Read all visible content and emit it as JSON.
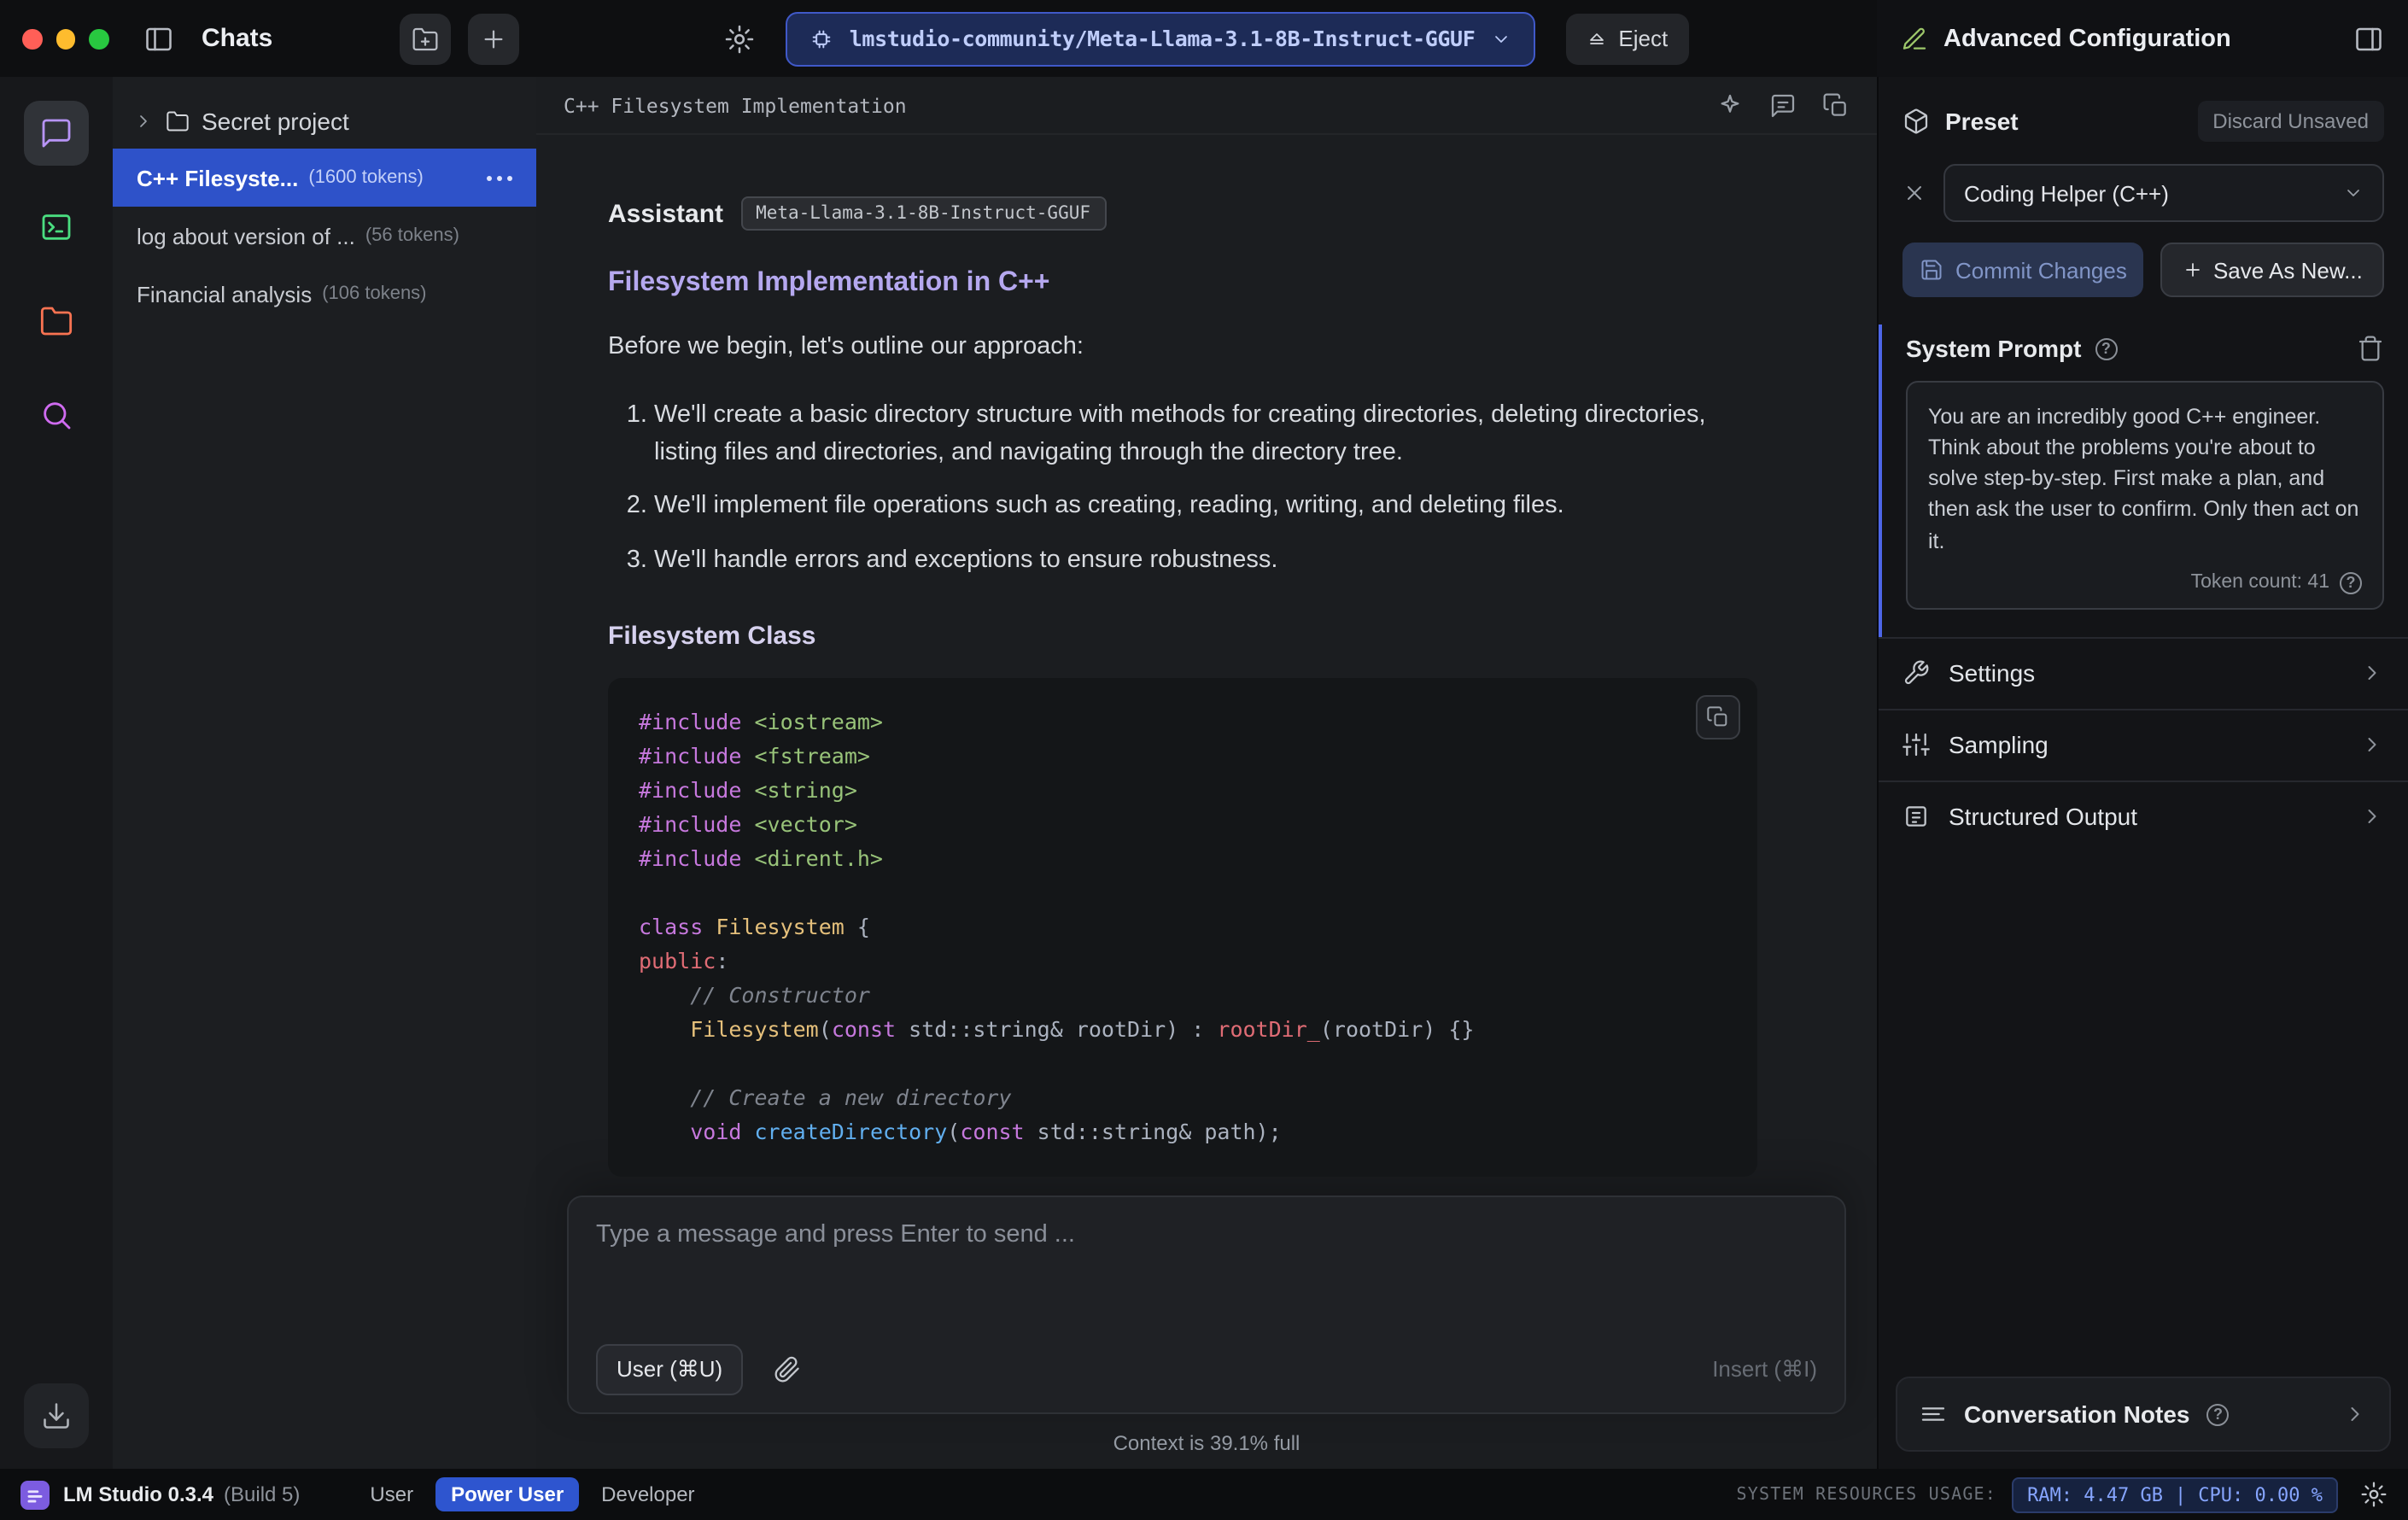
{
  "chats_panel": {
    "title": "Chats",
    "folder_label": "Secret project",
    "items": [
      {
        "label": "C++ Filesyste...",
        "tokens": "(1600 tokens)"
      },
      {
        "label": "log about version of ...",
        "tokens": "(56 tokens)"
      },
      {
        "label": "Financial analysis",
        "tokens": "(106 tokens)"
      }
    ]
  },
  "top_bar": {
    "model_name": "lmstudio-community/Meta-Llama-3.1-8B-Instruct-GGUF",
    "eject_label": "Eject"
  },
  "chat": {
    "header_title": "C++ Filesystem Implementation",
    "assistant_label": "Assistant",
    "model_badge": "Meta-Llama-3.1-8B-Instruct-GGUF",
    "heading_main": "Filesystem Implementation in C++",
    "intro": "Before we begin, let's outline our approach:",
    "list_items": [
      "We'll create a basic directory structure with methods for creating directories, deleting directories, listing files and directories, and navigating through the directory tree.",
      "We'll implement file operations such as creating, reading, writing, and deleting files.",
      "We'll handle errors and exceptions to ensure robustness."
    ],
    "heading_class": "Filesystem Class",
    "code_lines": [
      [
        [
          "kw",
          "#include "
        ],
        [
          "str",
          "<iostream>"
        ]
      ],
      [
        [
          "kw",
          "#include "
        ],
        [
          "str",
          "<fstream>"
        ]
      ],
      [
        [
          "kw",
          "#include "
        ],
        [
          "str",
          "<string>"
        ]
      ],
      [
        [
          "kw",
          "#include "
        ],
        [
          "str",
          "<vector>"
        ]
      ],
      [
        [
          "kw",
          "#include "
        ],
        [
          "str",
          "<dirent.h>"
        ]
      ],
      [],
      [
        [
          "kw",
          "class "
        ],
        [
          "type",
          "Filesystem "
        ],
        [
          "pln",
          "{"
        ]
      ],
      [
        [
          "var",
          "public"
        ],
        [
          "pln",
          ":"
        ]
      ],
      [
        [
          "com",
          "    // Constructor"
        ]
      ],
      [
        [
          "pln",
          "    "
        ],
        [
          "type",
          "Filesystem"
        ],
        [
          "pln",
          "("
        ],
        [
          "kw",
          "const"
        ],
        [
          "pln",
          " std::string& rootDir) : "
        ],
        [
          "var",
          "rootDir_"
        ],
        [
          "pln",
          "(rootDir) {}"
        ]
      ],
      [],
      [
        [
          "com",
          "    // Create a new directory"
        ]
      ],
      [
        [
          "pln",
          "    "
        ],
        [
          "kw",
          "void "
        ],
        [
          "fn",
          "createDirectory"
        ],
        [
          "pln",
          "("
        ],
        [
          "kw",
          "const"
        ],
        [
          "pln",
          " std::string& path);"
        ]
      ]
    ],
    "input_placeholder": "Type a message and press Enter to send ...",
    "user_button_label": "User (⌘U)",
    "insert_label": "Insert (⌘I)",
    "context_status": "Context is 39.1% full"
  },
  "config_panel": {
    "title": "Advanced Configuration",
    "preset_label": "Preset",
    "discard_label": "Discard Unsaved",
    "preset_value": "Coding Helper (C++)",
    "commit_label": "Commit Changes",
    "save_as_new_label": "Save As New...",
    "system_prompt_label": "System Prompt",
    "system_prompt_text": "You are an incredibly good C++ engineer. Think about the problems you're about to solve step-by-step. First make a plan, and then ask the user to confirm. Only then act on it.",
    "token_count": "Token count: 41",
    "sections": [
      {
        "label": "Settings"
      },
      {
        "label": "Sampling"
      },
      {
        "label": "Structured Output"
      }
    ],
    "notes_label": "Conversation Notes"
  },
  "status_bar": {
    "app_name": "LM Studio 0.3.4",
    "build": "(Build 5)",
    "modes": [
      "User",
      "Power User",
      "Developer"
    ],
    "active_mode": "Power User",
    "resources_label": "SYSTEM RESOURCES USAGE:",
    "ram": "RAM: 4.47 GB",
    "divider": "|",
    "cpu": "CPU: 0.00 %"
  },
  "colors": {
    "selection_blue": "#2e52c9",
    "accent_purple": "#b5a8ef",
    "model_pill_bg": "#1d2b57",
    "model_pill_border": "#4059c9"
  },
  "icons": [
    "close-icon",
    "minimize-icon",
    "zoom-icon",
    "panel-left-icon",
    "new-folder-icon",
    "new-chat-icon",
    "chat-bubble-icon",
    "terminal-icon",
    "folder-icon",
    "search-icon",
    "download-icon",
    "gear-icon",
    "chip-icon",
    "chevron-down-icon",
    "eject-icon",
    "sparkle-icon",
    "conversation-icon",
    "duplicate-icon",
    "copy-icon",
    "paperclip-icon",
    "pencil-icon",
    "panel-right-icon",
    "preset-box-icon",
    "close-x-icon",
    "save-icon",
    "plus-icon",
    "help-icon",
    "trash-icon",
    "wrench-icon",
    "sliders-icon",
    "structured-output-icon",
    "notes-icon",
    "chevron-right-icon",
    "ellipsis-icon",
    "lmstudio-logo"
  ]
}
